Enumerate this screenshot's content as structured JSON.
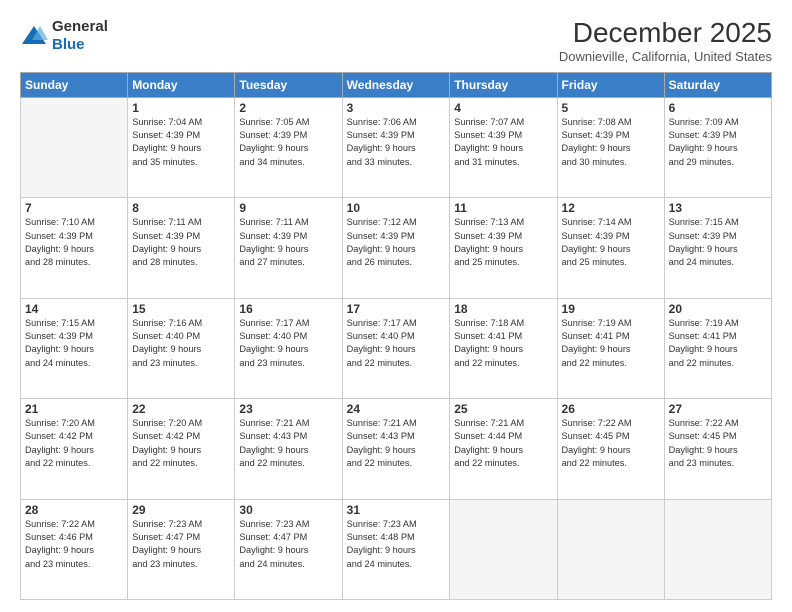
{
  "logo": {
    "general": "General",
    "blue": "Blue"
  },
  "header": {
    "month_title": "December 2025",
    "location": "Downieville, California, United States"
  },
  "days_of_week": [
    "Sunday",
    "Monday",
    "Tuesday",
    "Wednesday",
    "Thursday",
    "Friday",
    "Saturday"
  ],
  "weeks": [
    [
      {
        "day": "",
        "empty": true
      },
      {
        "day": "1",
        "sunrise": "7:04 AM",
        "sunset": "4:39 PM",
        "daylight": "9 hours and 35 minutes."
      },
      {
        "day": "2",
        "sunrise": "7:05 AM",
        "sunset": "4:39 PM",
        "daylight": "9 hours and 34 minutes."
      },
      {
        "day": "3",
        "sunrise": "7:06 AM",
        "sunset": "4:39 PM",
        "daylight": "9 hours and 33 minutes."
      },
      {
        "day": "4",
        "sunrise": "7:07 AM",
        "sunset": "4:39 PM",
        "daylight": "9 hours and 31 minutes."
      },
      {
        "day": "5",
        "sunrise": "7:08 AM",
        "sunset": "4:39 PM",
        "daylight": "9 hours and 30 minutes."
      },
      {
        "day": "6",
        "sunrise": "7:09 AM",
        "sunset": "4:39 PM",
        "daylight": "9 hours and 29 minutes."
      }
    ],
    [
      {
        "day": "7",
        "sunrise": "7:10 AM",
        "sunset": "4:39 PM",
        "daylight": "9 hours and 28 minutes."
      },
      {
        "day": "8",
        "sunrise": "7:11 AM",
        "sunset": "4:39 PM",
        "daylight": "9 hours and 28 minutes."
      },
      {
        "day": "9",
        "sunrise": "7:11 AM",
        "sunset": "4:39 PM",
        "daylight": "9 hours and 27 minutes."
      },
      {
        "day": "10",
        "sunrise": "7:12 AM",
        "sunset": "4:39 PM",
        "daylight": "9 hours and 26 minutes."
      },
      {
        "day": "11",
        "sunrise": "7:13 AM",
        "sunset": "4:39 PM",
        "daylight": "9 hours and 25 minutes."
      },
      {
        "day": "12",
        "sunrise": "7:14 AM",
        "sunset": "4:39 PM",
        "daylight": "9 hours and 25 minutes."
      },
      {
        "day": "13",
        "sunrise": "7:15 AM",
        "sunset": "4:39 PM",
        "daylight": "9 hours and 24 minutes."
      }
    ],
    [
      {
        "day": "14",
        "sunrise": "7:15 AM",
        "sunset": "4:39 PM",
        "daylight": "9 hours and 24 minutes."
      },
      {
        "day": "15",
        "sunrise": "7:16 AM",
        "sunset": "4:40 PM",
        "daylight": "9 hours and 23 minutes."
      },
      {
        "day": "16",
        "sunrise": "7:17 AM",
        "sunset": "4:40 PM",
        "daylight": "9 hours and 23 minutes."
      },
      {
        "day": "17",
        "sunrise": "7:17 AM",
        "sunset": "4:40 PM",
        "daylight": "9 hours and 22 minutes."
      },
      {
        "day": "18",
        "sunrise": "7:18 AM",
        "sunset": "4:41 PM",
        "daylight": "9 hours and 22 minutes."
      },
      {
        "day": "19",
        "sunrise": "7:19 AM",
        "sunset": "4:41 PM",
        "daylight": "9 hours and 22 minutes."
      },
      {
        "day": "20",
        "sunrise": "7:19 AM",
        "sunset": "4:41 PM",
        "daylight": "9 hours and 22 minutes."
      }
    ],
    [
      {
        "day": "21",
        "sunrise": "7:20 AM",
        "sunset": "4:42 PM",
        "daylight": "9 hours and 22 minutes."
      },
      {
        "day": "22",
        "sunrise": "7:20 AM",
        "sunset": "4:42 PM",
        "daylight": "9 hours and 22 minutes."
      },
      {
        "day": "23",
        "sunrise": "7:21 AM",
        "sunset": "4:43 PM",
        "daylight": "9 hours and 22 minutes."
      },
      {
        "day": "24",
        "sunrise": "7:21 AM",
        "sunset": "4:43 PM",
        "daylight": "9 hours and 22 minutes."
      },
      {
        "day": "25",
        "sunrise": "7:21 AM",
        "sunset": "4:44 PM",
        "daylight": "9 hours and 22 minutes."
      },
      {
        "day": "26",
        "sunrise": "7:22 AM",
        "sunset": "4:45 PM",
        "daylight": "9 hours and 22 minutes."
      },
      {
        "day": "27",
        "sunrise": "7:22 AM",
        "sunset": "4:45 PM",
        "daylight": "9 hours and 23 minutes."
      }
    ],
    [
      {
        "day": "28",
        "sunrise": "7:22 AM",
        "sunset": "4:46 PM",
        "daylight": "9 hours and 23 minutes."
      },
      {
        "day": "29",
        "sunrise": "7:23 AM",
        "sunset": "4:47 PM",
        "daylight": "9 hours and 23 minutes."
      },
      {
        "day": "30",
        "sunrise": "7:23 AM",
        "sunset": "4:47 PM",
        "daylight": "9 hours and 24 minutes."
      },
      {
        "day": "31",
        "sunrise": "7:23 AM",
        "sunset": "4:48 PM",
        "daylight": "9 hours and 24 minutes."
      },
      {
        "day": "",
        "empty": true
      },
      {
        "day": "",
        "empty": true
      },
      {
        "day": "",
        "empty": true
      }
    ]
  ],
  "labels": {
    "sunrise": "Sunrise:",
    "sunset": "Sunset:",
    "daylight": "Daylight:"
  }
}
